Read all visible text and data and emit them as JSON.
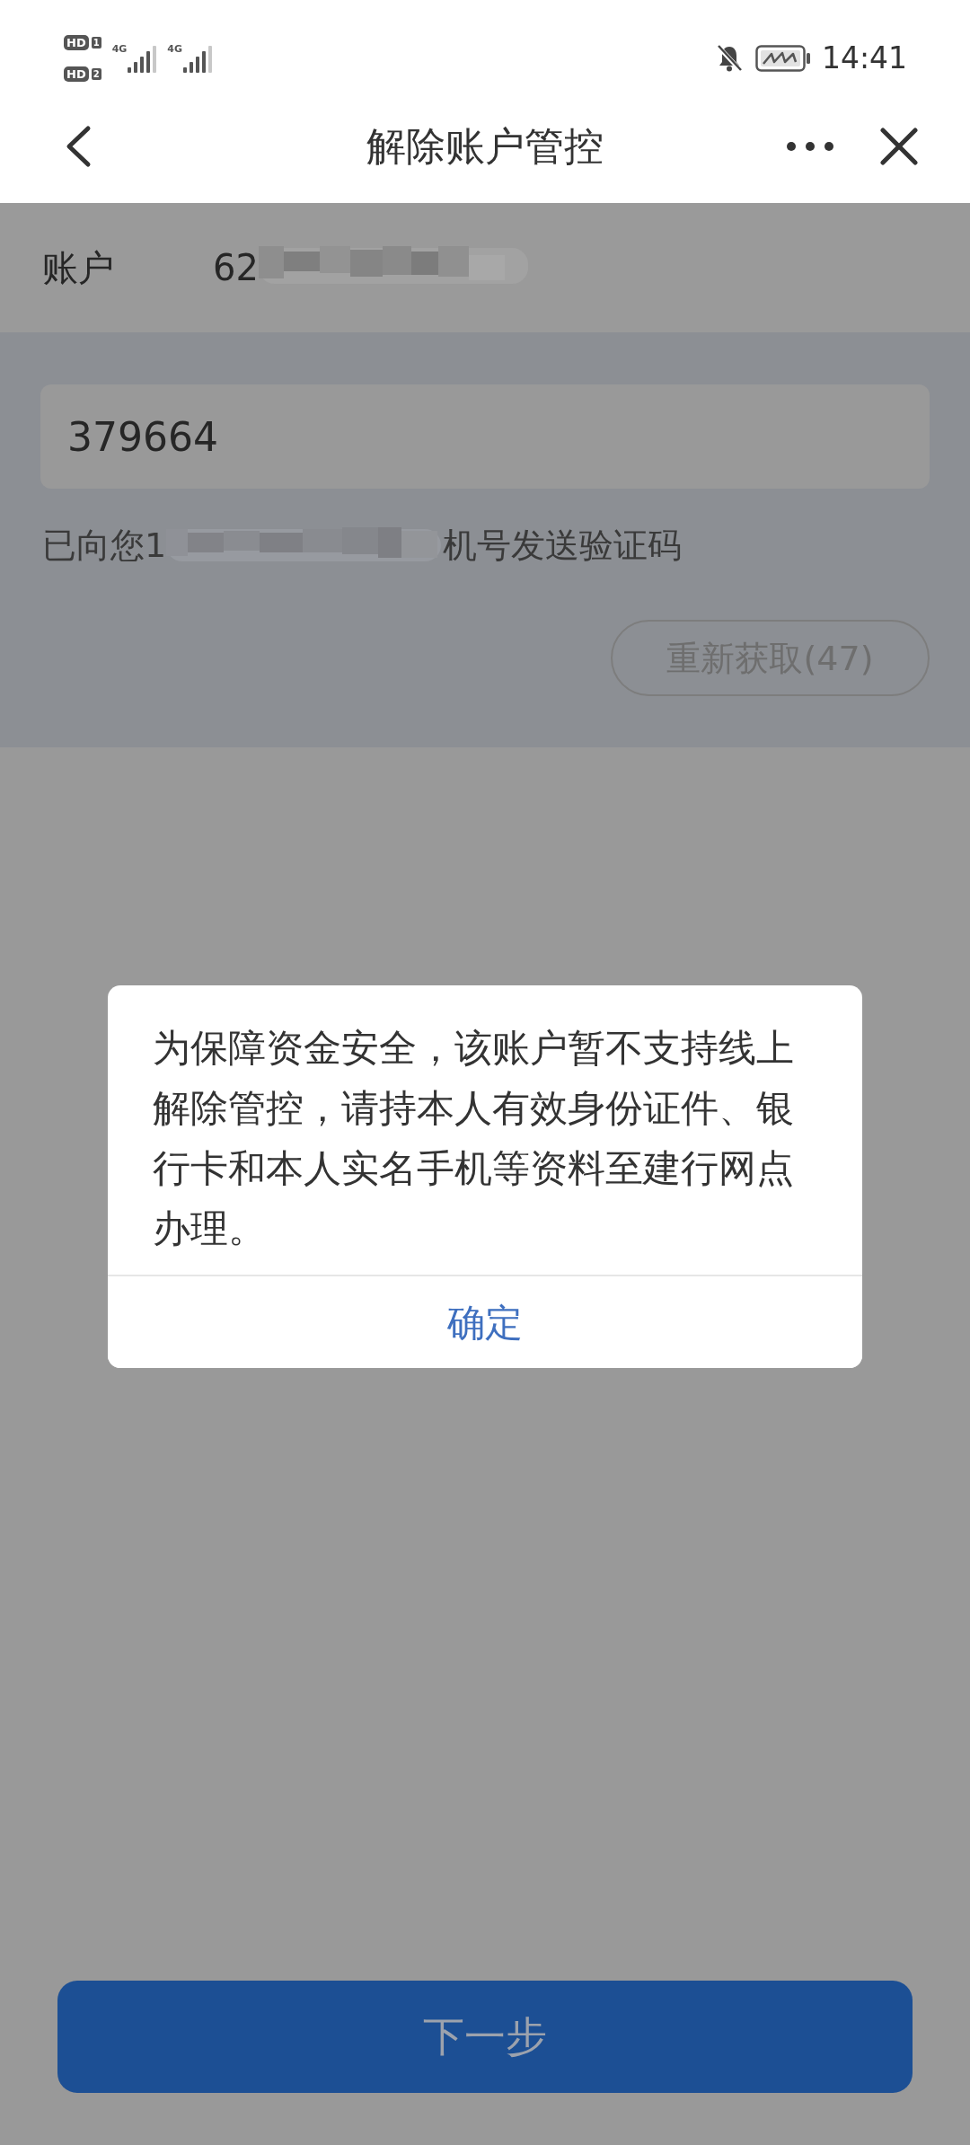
{
  "status_bar": {
    "sims": [
      {
        "badge": "HD",
        "slot": "1",
        "network": "4G"
      },
      {
        "badge": "HD",
        "slot": "2",
        "network": "4G"
      }
    ],
    "time": "14:41"
  },
  "header": {
    "title": "解除账户管控"
  },
  "account": {
    "label": "账户",
    "number_visible": "62"
  },
  "verification": {
    "code": "379664",
    "notice_start": "已向您1",
    "notice_end": "机号发送验证码",
    "resend_button": "重新获取(47)"
  },
  "dialog": {
    "message": "为保障资金安全，该账户暂不支持线上解除管控，请持本人有效身份证件、银行卡和本人实名手机等资料至建行网点办理。",
    "confirm_button": "确定"
  },
  "next_button": {
    "label": "下一步",
    "disabled": true
  }
}
